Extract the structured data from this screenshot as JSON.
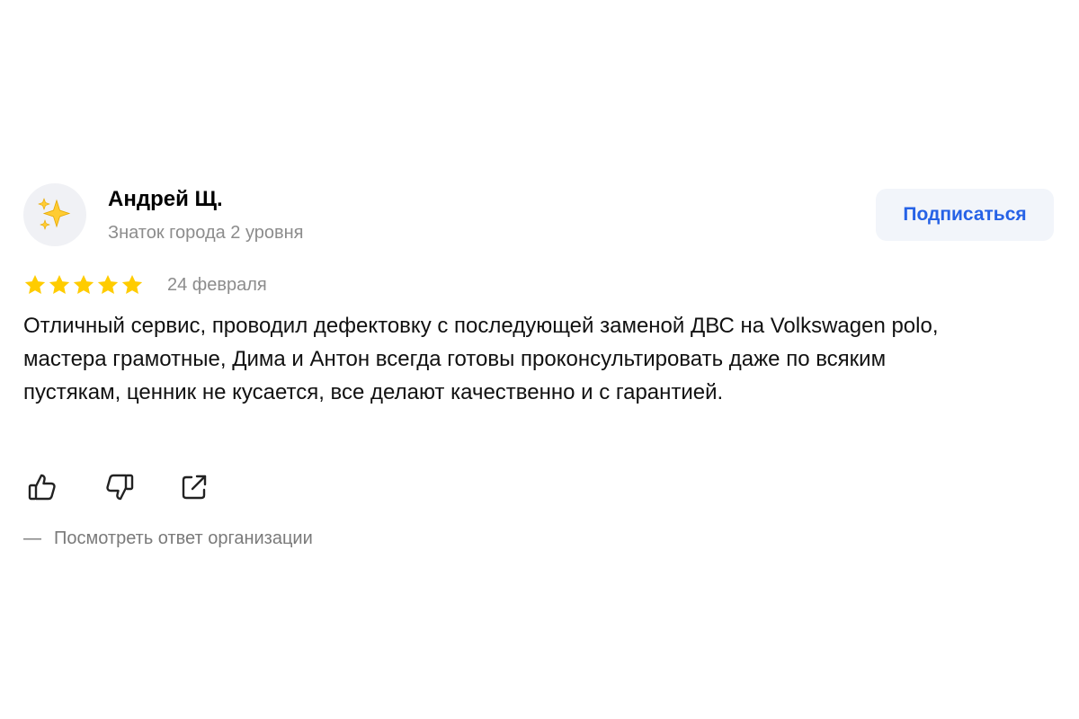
{
  "review": {
    "author": {
      "name": "Андрей Щ.",
      "level": "Знаток города 2 уровня",
      "avatar_icon": "sparkles-icon"
    },
    "subscribe_label": "Подписаться",
    "rating": 5,
    "rating_max": 5,
    "date": "24 февраля",
    "text": "Отличный сервис, проводил дефектовку с последующей заменой ДВС на Volkswagen polo, мастера грамотные, Дима и Антон всегда готовы проконсультировать даже по всяким пустякам, ценник не кусается, все делают качественно и с гарантией.",
    "actions": [
      "like-icon",
      "dislike-icon",
      "share-icon"
    ],
    "org_reply": {
      "dash": "—",
      "label": "Посмотреть ответ организации"
    }
  },
  "colors": {
    "star": "#ffcc00",
    "accent_blue": "#2662e6",
    "muted_text": "#8c8c8c",
    "button_bg": "#f2f5fa"
  }
}
